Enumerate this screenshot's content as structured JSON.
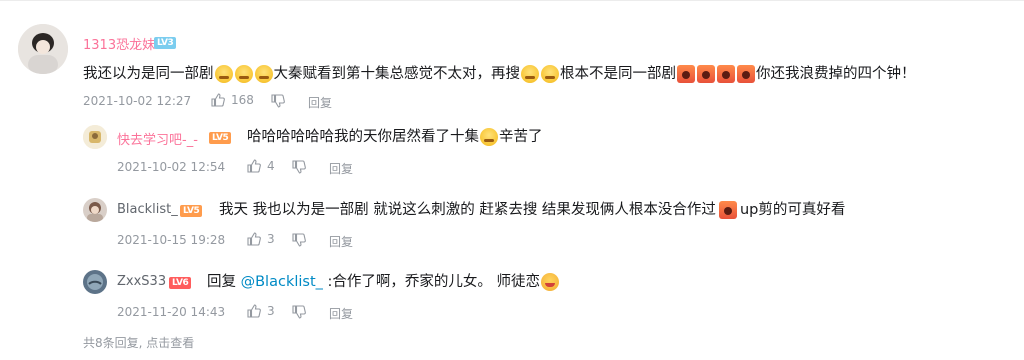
{
  "main_comment": {
    "username": "1313恐龙妹",
    "level": "LV3",
    "text_a": "我还以为是同一部剧",
    "text_b": "大秦赋看到第十集总感觉不太对，再搜",
    "text_c": "根本不是同一部剧",
    "text_d": "你还我浪费掉的四个钟！",
    "date": "2021-10-02 12:27",
    "likes": "168",
    "reply_label": "回复"
  },
  "replies": [
    {
      "username": "快去学习吧-_-",
      "level": "LV5",
      "text_a": "哈哈哈哈哈哈我的天你居然看了十集",
      "text_b": "辛苦了",
      "date": "2021-10-02 12:54",
      "likes": "4",
      "reply_label": "回复"
    },
    {
      "username": "Blacklist_",
      "level": "LV5",
      "text_a": "我天 我也以为是一部剧 就说这么刺激的 赶紧去搜 结果发现俩人根本没合作过",
      "text_b": "up剪的可真好看",
      "date": "2021-10-15 19:28",
      "likes": "3",
      "reply_label": "回复"
    },
    {
      "username": "ZxxS33",
      "level": "LV6",
      "prefix": "回复",
      "mention": "@Blacklist_",
      "text_a": ":合作了啊，乔家的儿女。 师徒恋",
      "date": "2021-11-20 14:43",
      "likes": "3",
      "reply_label": "回复"
    }
  ],
  "footer": {
    "more_replies": "共8条回复, 点击查看"
  },
  "icons": [
    "avatar",
    "thumbs-up-icon",
    "thumbs-down-icon",
    "doge-emoji-icon",
    "cry-emoji-icon",
    "smile-emoji-icon"
  ],
  "colors": {
    "username": "#fb7299",
    "meta": "#9499a0",
    "mention": "#008ac5",
    "text": "#18191c"
  }
}
